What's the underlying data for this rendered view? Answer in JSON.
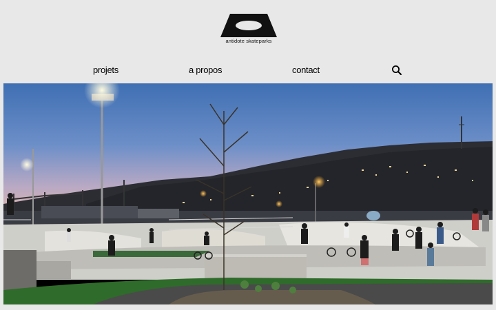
{
  "brand": {
    "name": "antidote skateparks"
  },
  "nav": {
    "items": [
      {
        "label": "projets"
      },
      {
        "label": "a propos"
      },
      {
        "label": "contact"
      }
    ],
    "search_icon": "search-icon"
  },
  "hero": {
    "image": "skatepark-dusk-photo"
  },
  "colors": {
    "background": "#e8e8e8",
    "text": "#000000"
  }
}
